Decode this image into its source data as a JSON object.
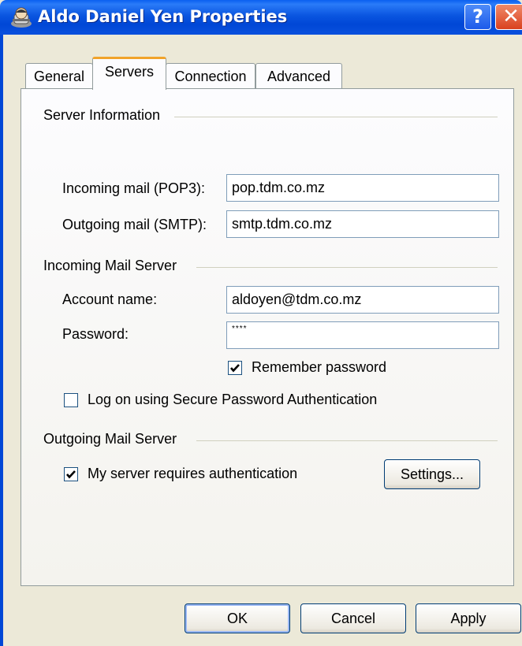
{
  "window": {
    "title": "Aldo Daniel Yen Properties",
    "help_label": "?",
    "close_label": "✕"
  },
  "tabs": [
    {
      "label": "General",
      "selected": false
    },
    {
      "label": "Servers",
      "selected": true
    },
    {
      "label": "Connection",
      "selected": false
    },
    {
      "label": "Advanced",
      "selected": false
    }
  ],
  "server_information": {
    "group_label": "Server Information",
    "incoming_label": "Incoming mail (POP3):",
    "incoming_value": "pop.tdm.co.mz",
    "outgoing_label": "Outgoing mail (SMTP):",
    "outgoing_value": "smtp.tdm.co.mz"
  },
  "incoming_mail_server": {
    "group_label": "Incoming Mail Server",
    "account_label": "Account name:",
    "account_value": "aldoyen@tdm.co.mz",
    "password_label": "Password:",
    "password_value": "****",
    "remember_label": "Remember password",
    "remember_checked": true,
    "spa_label": "Log on using Secure Password Authentication",
    "spa_checked": false
  },
  "outgoing_mail_server": {
    "group_label": "Outgoing Mail Server",
    "auth_label": "My server requires authentication",
    "auth_checked": true,
    "settings_label": "Settings..."
  },
  "footer": {
    "ok_label": "OK",
    "cancel_label": "Cancel",
    "apply_label": "Apply"
  },
  "colors": {
    "titlebar": "#0047d6",
    "tab_highlight": "#f1a32a",
    "dialog_bg": "#ece9d8"
  },
  "icons": {
    "title": "account-properties-icon",
    "help": "help-icon",
    "close": "close-icon",
    "check": "checkmark-icon"
  }
}
